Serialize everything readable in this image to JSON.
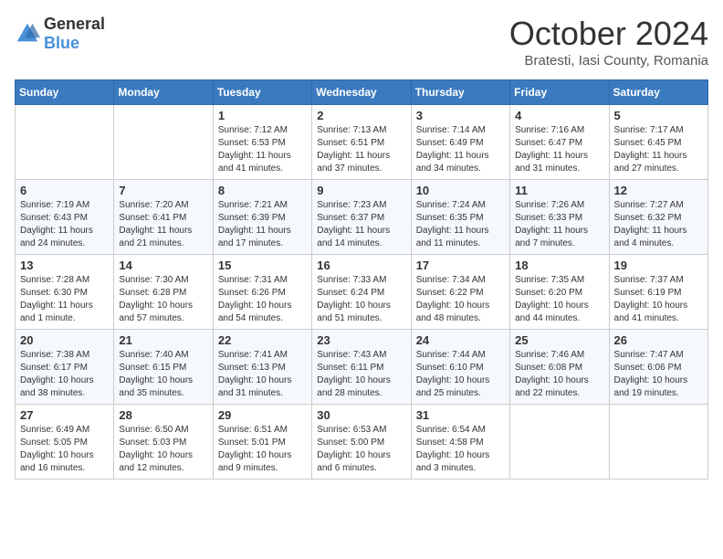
{
  "logo": {
    "general": "General",
    "blue": "Blue"
  },
  "header": {
    "month": "October 2024",
    "location": "Bratesti, Iasi County, Romania"
  },
  "weekdays": [
    "Sunday",
    "Monday",
    "Tuesday",
    "Wednesday",
    "Thursday",
    "Friday",
    "Saturday"
  ],
  "weeks": [
    [
      {
        "day": "",
        "info": ""
      },
      {
        "day": "",
        "info": ""
      },
      {
        "day": "1",
        "info": "Sunrise: 7:12 AM\nSunset: 6:53 PM\nDaylight: 11 hours and 41 minutes."
      },
      {
        "day": "2",
        "info": "Sunrise: 7:13 AM\nSunset: 6:51 PM\nDaylight: 11 hours and 37 minutes."
      },
      {
        "day": "3",
        "info": "Sunrise: 7:14 AM\nSunset: 6:49 PM\nDaylight: 11 hours and 34 minutes."
      },
      {
        "day": "4",
        "info": "Sunrise: 7:16 AM\nSunset: 6:47 PM\nDaylight: 11 hours and 31 minutes."
      },
      {
        "day": "5",
        "info": "Sunrise: 7:17 AM\nSunset: 6:45 PM\nDaylight: 11 hours and 27 minutes."
      }
    ],
    [
      {
        "day": "6",
        "info": "Sunrise: 7:19 AM\nSunset: 6:43 PM\nDaylight: 11 hours and 24 minutes."
      },
      {
        "day": "7",
        "info": "Sunrise: 7:20 AM\nSunset: 6:41 PM\nDaylight: 11 hours and 21 minutes."
      },
      {
        "day": "8",
        "info": "Sunrise: 7:21 AM\nSunset: 6:39 PM\nDaylight: 11 hours and 17 minutes."
      },
      {
        "day": "9",
        "info": "Sunrise: 7:23 AM\nSunset: 6:37 PM\nDaylight: 11 hours and 14 minutes."
      },
      {
        "day": "10",
        "info": "Sunrise: 7:24 AM\nSunset: 6:35 PM\nDaylight: 11 hours and 11 minutes."
      },
      {
        "day": "11",
        "info": "Sunrise: 7:26 AM\nSunset: 6:33 PM\nDaylight: 11 hours and 7 minutes."
      },
      {
        "day": "12",
        "info": "Sunrise: 7:27 AM\nSunset: 6:32 PM\nDaylight: 11 hours and 4 minutes."
      }
    ],
    [
      {
        "day": "13",
        "info": "Sunrise: 7:28 AM\nSunset: 6:30 PM\nDaylight: 11 hours and 1 minute."
      },
      {
        "day": "14",
        "info": "Sunrise: 7:30 AM\nSunset: 6:28 PM\nDaylight: 10 hours and 57 minutes."
      },
      {
        "day": "15",
        "info": "Sunrise: 7:31 AM\nSunset: 6:26 PM\nDaylight: 10 hours and 54 minutes."
      },
      {
        "day": "16",
        "info": "Sunrise: 7:33 AM\nSunset: 6:24 PM\nDaylight: 10 hours and 51 minutes."
      },
      {
        "day": "17",
        "info": "Sunrise: 7:34 AM\nSunset: 6:22 PM\nDaylight: 10 hours and 48 minutes."
      },
      {
        "day": "18",
        "info": "Sunrise: 7:35 AM\nSunset: 6:20 PM\nDaylight: 10 hours and 44 minutes."
      },
      {
        "day": "19",
        "info": "Sunrise: 7:37 AM\nSunset: 6:19 PM\nDaylight: 10 hours and 41 minutes."
      }
    ],
    [
      {
        "day": "20",
        "info": "Sunrise: 7:38 AM\nSunset: 6:17 PM\nDaylight: 10 hours and 38 minutes."
      },
      {
        "day": "21",
        "info": "Sunrise: 7:40 AM\nSunset: 6:15 PM\nDaylight: 10 hours and 35 minutes."
      },
      {
        "day": "22",
        "info": "Sunrise: 7:41 AM\nSunset: 6:13 PM\nDaylight: 10 hours and 31 minutes."
      },
      {
        "day": "23",
        "info": "Sunrise: 7:43 AM\nSunset: 6:11 PM\nDaylight: 10 hours and 28 minutes."
      },
      {
        "day": "24",
        "info": "Sunrise: 7:44 AM\nSunset: 6:10 PM\nDaylight: 10 hours and 25 minutes."
      },
      {
        "day": "25",
        "info": "Sunrise: 7:46 AM\nSunset: 6:08 PM\nDaylight: 10 hours and 22 minutes."
      },
      {
        "day": "26",
        "info": "Sunrise: 7:47 AM\nSunset: 6:06 PM\nDaylight: 10 hours and 19 minutes."
      }
    ],
    [
      {
        "day": "27",
        "info": "Sunrise: 6:49 AM\nSunset: 5:05 PM\nDaylight: 10 hours and 16 minutes."
      },
      {
        "day": "28",
        "info": "Sunrise: 6:50 AM\nSunset: 5:03 PM\nDaylight: 10 hours and 12 minutes."
      },
      {
        "day": "29",
        "info": "Sunrise: 6:51 AM\nSunset: 5:01 PM\nDaylight: 10 hours and 9 minutes."
      },
      {
        "day": "30",
        "info": "Sunrise: 6:53 AM\nSunset: 5:00 PM\nDaylight: 10 hours and 6 minutes."
      },
      {
        "day": "31",
        "info": "Sunrise: 6:54 AM\nSunset: 4:58 PM\nDaylight: 10 hours and 3 minutes."
      },
      {
        "day": "",
        "info": ""
      },
      {
        "day": "",
        "info": ""
      }
    ]
  ]
}
